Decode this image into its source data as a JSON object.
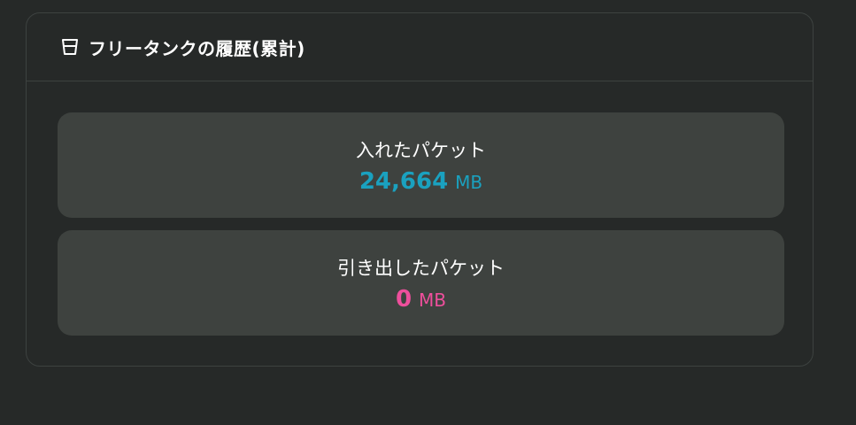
{
  "header": {
    "icon": "tank-icon",
    "title": "フリータンクの履歴(累計)"
  },
  "packets_in": {
    "label": "入れたパケット",
    "value": "24,664",
    "unit": "MB",
    "color": "#1aa1bf"
  },
  "packets_out": {
    "label": "引き出したパケット",
    "value": "0",
    "unit": "MB",
    "color": "#ee4f9c"
  }
}
